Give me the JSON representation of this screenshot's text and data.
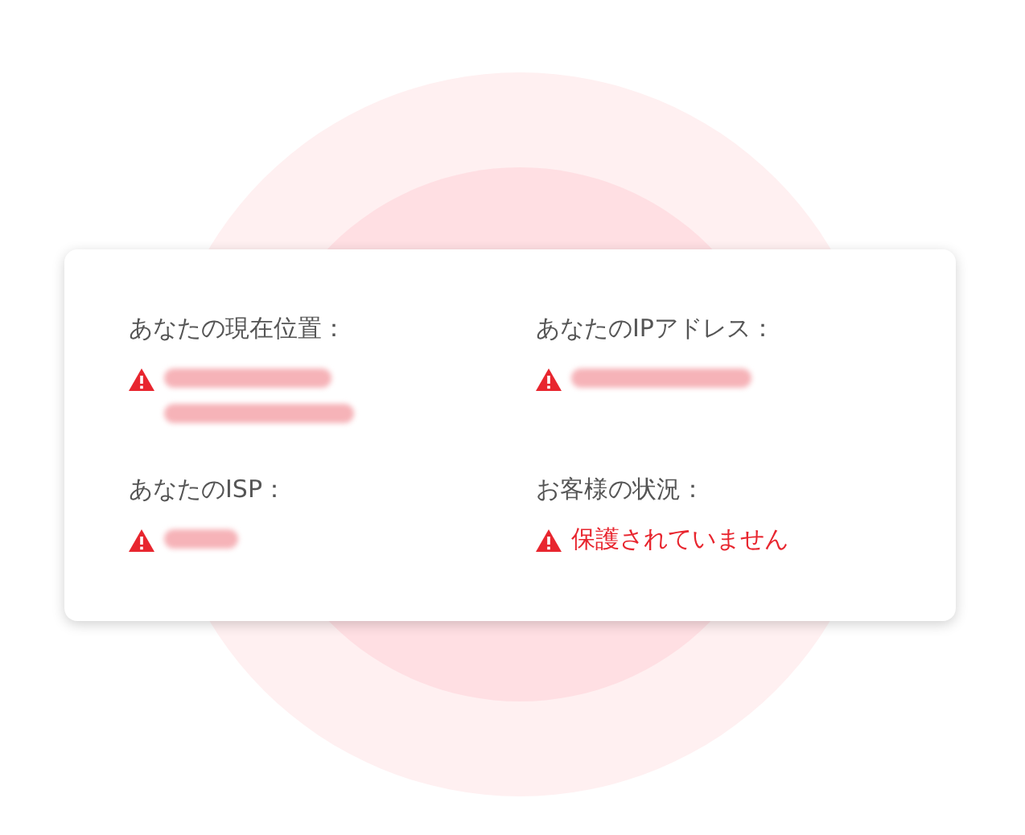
{
  "items": [
    {
      "label": "あなたの現在位置：",
      "redacted": true
    },
    {
      "label": "あなたのIPアドレス：",
      "redacted": true
    },
    {
      "label": "あなたのISP：",
      "redacted": true
    },
    {
      "label": "お客様の状況：",
      "redacted": false,
      "value": "保護されていません"
    }
  ]
}
